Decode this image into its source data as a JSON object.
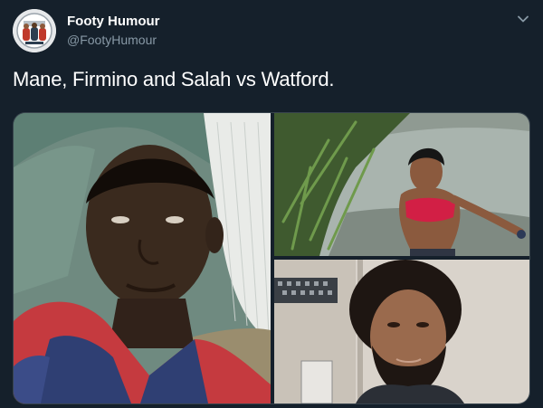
{
  "account": {
    "display_name": "Footy Humour",
    "handle": "@FootyHumour",
    "avatar_icon": "football-crest-avatar-icon"
  },
  "menu": {
    "icon": "chevron-down-icon"
  },
  "tweet": {
    "text": "Mane, Firmino and Salah vs Watford."
  },
  "media": {
    "photos": [
      {
        "icon": "photo-man-lying-on-sacks"
      },
      {
        "icon": "photo-man-in-river"
      },
      {
        "icon": "photo-curly-haired-man-selfie"
      }
    ]
  },
  "colors": {
    "background": "#15202b",
    "secondary_text": "#8899a6",
    "border": "#38444d"
  }
}
